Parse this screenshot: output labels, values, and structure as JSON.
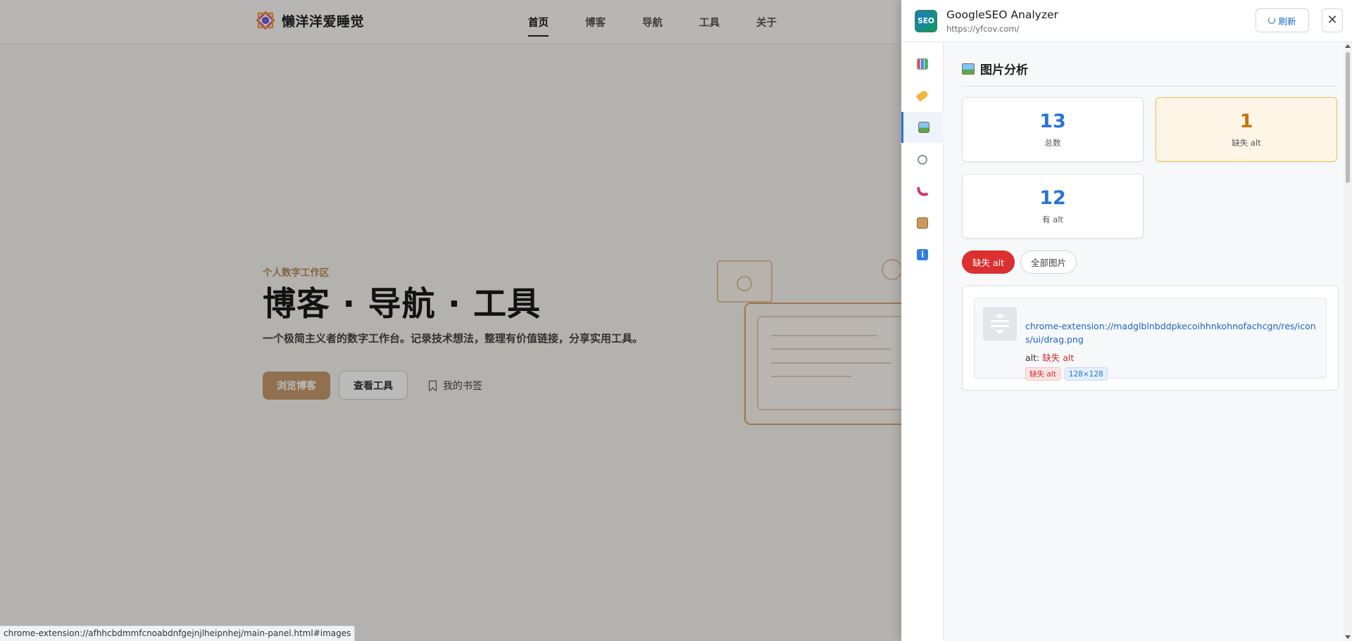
{
  "site": {
    "logo_text": "懒洋洋爱睡觉",
    "nav": [
      "首页",
      "博客",
      "导航",
      "工具",
      "关于"
    ],
    "hero": {
      "eyebrow": "个人数字工作区",
      "title": "博客 · 导航 · 工具",
      "description": "一个极简主义者的数字工作台。记录技术想法，整理有价值链接，分享实用工具。",
      "primary_button": "浏览博客",
      "secondary_button": "查看工具",
      "link_button": "我的书签"
    }
  },
  "statusbar": {
    "text": "chrome-extension://afhhcbdmmfcnoabdnfgejnjlheipnhej/main-panel.html#images"
  },
  "panel": {
    "logo_text": "SEO",
    "title": "GoogleSEO Analyzer",
    "url": "https://yfcov.com/",
    "refresh_label": "刷新",
    "close_label": "✕",
    "side_nav": [
      "chart-icon",
      "tag-icon",
      "image-icon",
      "link-icon",
      "phone-icon",
      "package-icon",
      "info-icon"
    ],
    "active_side_nav": "image-icon",
    "section_title": "图片分析",
    "stats": {
      "total": {
        "value": "13",
        "label": "总数"
      },
      "missing_alt": {
        "value": "1",
        "label": "缺失 alt"
      },
      "has_alt": {
        "value": "12",
        "label": "有 alt"
      }
    },
    "filters": {
      "active": "缺失 alt",
      "all": "全部图片"
    },
    "images": [
      {
        "src": "chrome-extension://madglblnbddpkecoihhnkohnofachcgn/res/icons/ui/drag.png",
        "alt_prefix": "alt:",
        "alt_value": "缺失 alt",
        "badge_missing": "缺失 alt",
        "badge_size": "128×128"
      }
    ],
    "colors": {
      "accent": "#2a74d4",
      "danger": "#dc2f2f",
      "warning": "#f0c05a"
    }
  }
}
